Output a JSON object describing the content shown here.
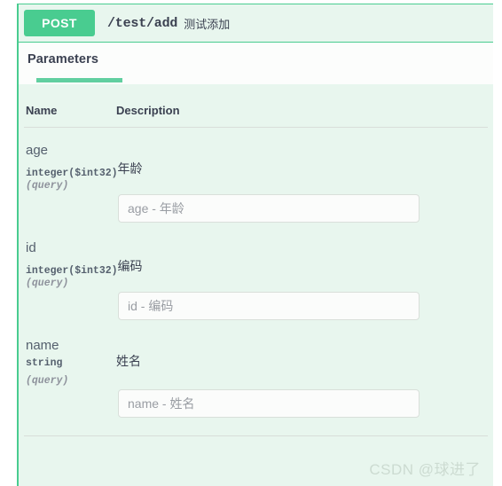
{
  "operation": {
    "method": "POST",
    "path": "/test/add",
    "summary": "测试添加"
  },
  "tabs": [
    {
      "label": "Parameters",
      "active": true
    }
  ],
  "table": {
    "headers": {
      "name": "Name",
      "description": "Description"
    }
  },
  "parameters": [
    {
      "name": "age",
      "type": "integer($int32)",
      "in": "(query)",
      "description": "年龄",
      "description_inline": true,
      "value": "",
      "placeholder": "age - 年龄"
    },
    {
      "name": "id",
      "type": "integer($int32)",
      "in": "(query)",
      "description": "编码",
      "description_inline": true,
      "value": "",
      "placeholder": "id - 编码"
    },
    {
      "name": "name",
      "type": "string",
      "in": "(query)",
      "description": "姓名",
      "description_inline": false,
      "value": "",
      "placeholder": "name - 姓名"
    }
  ],
  "watermark": "CSDN @球进了",
  "colors": {
    "method_post": "#49cc90",
    "panel_bg": "#e8f6ee",
    "tab_underline": "#61cfa0",
    "border_accent": "#49cc90",
    "text_primary": "#3b4151",
    "text_muted": "#8d919b"
  }
}
